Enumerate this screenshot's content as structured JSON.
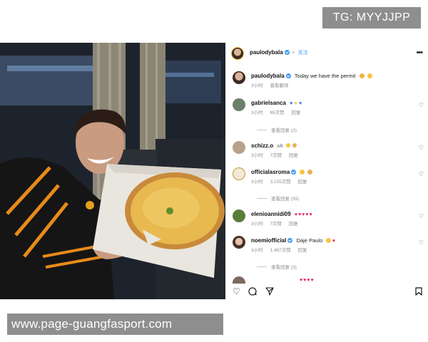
{
  "watermark_top": "TG: MYYJJPP",
  "watermark_bottom": "www.page-guangfasport.com",
  "post": {
    "username": "paulodybala",
    "follow_label": "关注",
    "caption": {
      "username": "paulodybala",
      "text": "Today we have the permit",
      "time": "3小时",
      "translate": "查看翻译"
    }
  },
  "comments": [
    {
      "username": "gabrielsanca",
      "text": "",
      "time": "3小时",
      "likes": "65次赞",
      "reply": "回复",
      "replies_label": "查看回复 (2)"
    },
    {
      "username": "schizz.o",
      "text": "AR",
      "time": "3小时",
      "likes": "7次赞",
      "reply": "回复",
      "replies_label": ""
    },
    {
      "username": "officialasroma",
      "text": "",
      "time": "3小时",
      "likes": "3,155次赞",
      "reply": "回复",
      "replies_label": "查看回复 (55)"
    },
    {
      "username": "elenioannidi09",
      "text": "",
      "time": "3小时",
      "likes": "7次赞",
      "reply": "回复",
      "replies_label": ""
    },
    {
      "username": "noemiofficial",
      "text": "Daje Paulo",
      "time": "3小时",
      "likes": "1,467次赞",
      "reply": "回复",
      "replies_label": "查看回复 (3)"
    }
  ],
  "icons": {
    "like": "heart-icon",
    "comment": "comment-icon",
    "share": "share-icon",
    "save": "bookmark-icon",
    "more": "more-icon"
  },
  "colors": {
    "accent": "#3897f0",
    "watermark_bg": "#8e8e8e",
    "emoji_heart": "#e0245e",
    "emoji_yellow": "#f5c542",
    "emoji_blue": "#2d6fd6"
  }
}
